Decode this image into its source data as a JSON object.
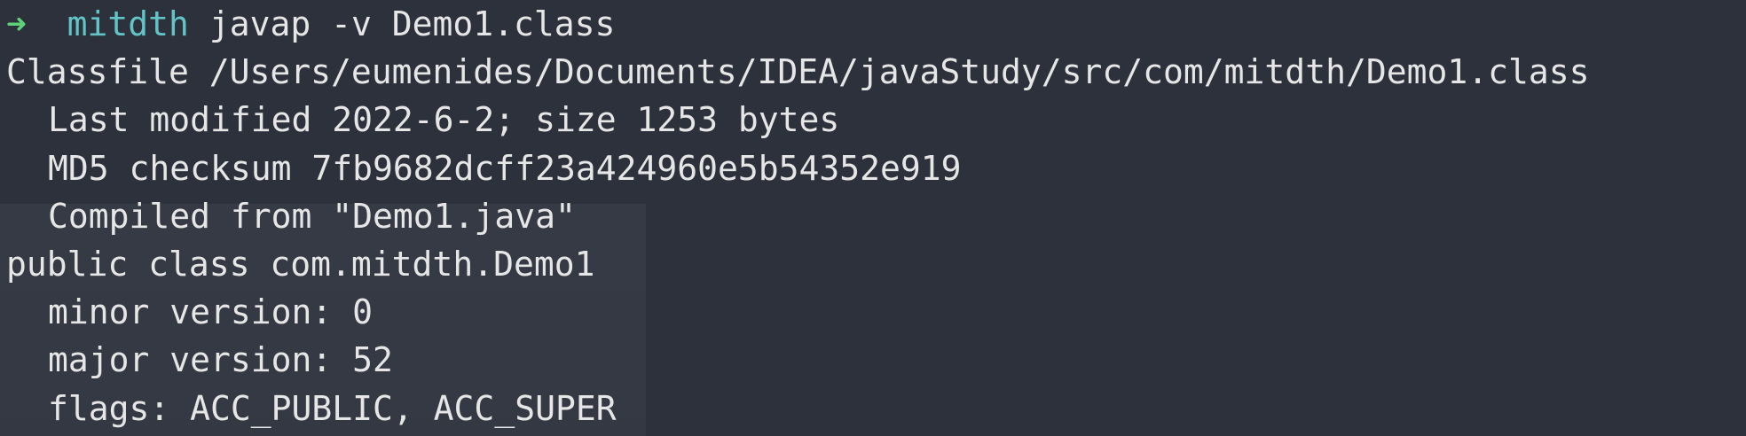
{
  "prompt": {
    "arrow": "➜",
    "directory": "mitdth",
    "command": "javap -v Demo1.class"
  },
  "output": {
    "classfile": "Classfile /Users/eumenides/Documents/IDEA/javaStudy/src/com/mitdth/Demo1.class",
    "last_modified": "Last modified 2022-6-2; size 1253 bytes",
    "md5": "MD5 checksum 7fb9682dcff23a424960e5b54352e919",
    "compiled_from": "Compiled from \"Demo1.java\"",
    "class_decl": "public class com.mitdth.Demo1",
    "minor_version": "minor version: 0",
    "major_version": "major version: 52",
    "flags": "flags: ACC_PUBLIC, ACC_SUPER"
  },
  "colors": {
    "background": "#2d313b",
    "text": "#e6e6e6",
    "prompt_arrow": "#5fd17a",
    "prompt_directory": "#62c4c7"
  }
}
